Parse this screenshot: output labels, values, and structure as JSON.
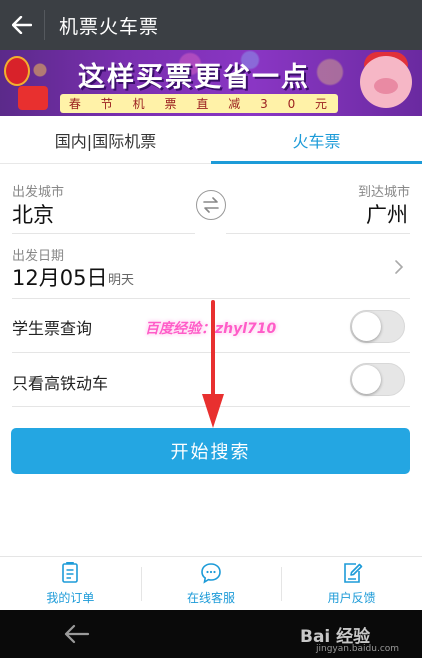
{
  "header": {
    "title": "机票火车票"
  },
  "banner": {
    "headline": "这样买票更省一点",
    "promo": [
      "春",
      "节",
      "机",
      "票",
      "直",
      "减",
      "3",
      "0",
      "元"
    ]
  },
  "tabs": [
    {
      "label": "国内|国际机票",
      "active": false
    },
    {
      "label": "火车票",
      "active": true
    }
  ],
  "route": {
    "from_label": "出发城市",
    "from_value": "北京",
    "to_label": "到达城市",
    "to_value": "广州"
  },
  "date": {
    "label": "出发日期",
    "value": "12月05日",
    "weekday": "明天"
  },
  "options": [
    {
      "label": "学生票查询",
      "on": false
    },
    {
      "label": "只看高铁动车",
      "on": false
    }
  ],
  "watermark": "百度经验：zhyl710",
  "search_button": "开始搜索",
  "bottom_nav": [
    {
      "label": "我的订单",
      "icon": "order-icon"
    },
    {
      "label": "在线客服",
      "icon": "chat-icon"
    },
    {
      "label": "用户反馈",
      "icon": "feedback-icon"
    }
  ],
  "system_bar": {
    "brand": "Bai 经验",
    "brand_sub": "jingyan.baidu.com"
  },
  "colors": {
    "accent": "#1d9bd8",
    "button": "#24a6e2",
    "header": "#3b3f44",
    "annotation_arrow": "#e8302f"
  }
}
